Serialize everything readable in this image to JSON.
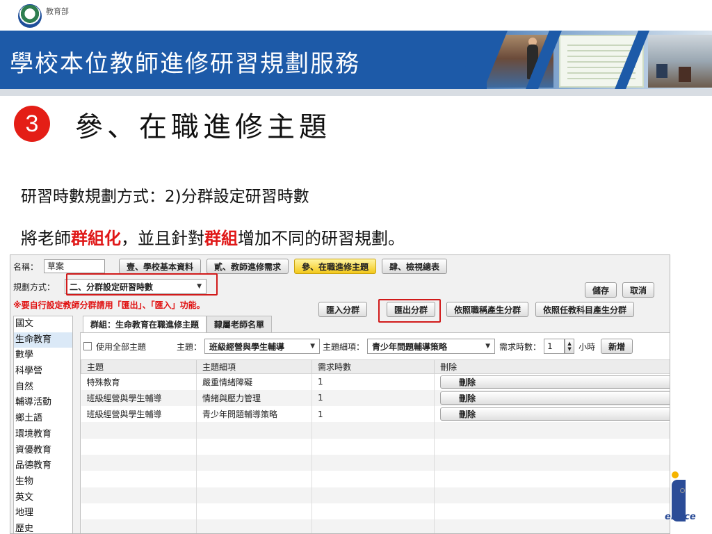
{
  "ministry": {
    "name": "教育部"
  },
  "banner": {
    "title": "學校本位教師進修研習規劃服務"
  },
  "step": {
    "number": "3",
    "title": "參、在職進修主題"
  },
  "description": {
    "line1": "研習時數規劃方式：2)分群設定研習時數",
    "line2_parts": [
      "將老師",
      "群組化",
      "，並且針對",
      "群組",
      "增加不同的研習規劃。"
    ]
  },
  "app": {
    "name_label": "名稱：",
    "name_value": "草案",
    "tabs": [
      "壹、學校基本資料",
      "貳、教師進修需求",
      "參、在職進修主題",
      "肆、檢視總表"
    ],
    "active_tab": 2,
    "plan_label": "規劃方式：",
    "plan_value": "二、分群設定研習時數",
    "save_label": "儲存",
    "cancel_label": "取消",
    "warning": "※要自行設定教師分群請用「匯出」、「匯入」功能。",
    "import_label": "匯入分群",
    "export_label": "匯出分群",
    "by_title_label": "依照職稱產生分群",
    "by_subject_label": "依照任教科目產生分群",
    "subjects": [
      "國文",
      "生命教育",
      "數學",
      "科學營",
      "自然",
      "輔導活動",
      "鄉土語",
      "環境教育",
      "資優教育",
      "品德教育",
      "生物",
      "英文",
      "地理",
      "歷史"
    ],
    "selected_subject": 1,
    "group_tab_label": "群組：生命教育在職進修主題",
    "member_tab_label": "隸屬老師名單",
    "use_all_label": "使用全部主題",
    "topic_label": "主題：",
    "topic_value": "班級經營與學生輔導",
    "subtopic_label": "主題細項：",
    "subtopic_value": "青少年問題輔導策略",
    "hours_label": "需求時數：",
    "hours_value": "1",
    "hours_unit": "小時",
    "add_label": "新增",
    "columns": [
      "主題",
      "主題細項",
      "需求時數",
      "刪除"
    ],
    "rows": [
      {
        "topic": "特殊教育",
        "subtopic": "嚴重情緒障礙",
        "hours": "1",
        "delete": "刪除"
      },
      {
        "topic": "班級經營與學生輔導",
        "subtopic": "情緒與壓力管理",
        "hours": "1",
        "delete": "刪除"
      },
      {
        "topic": "班級經營與學生輔導",
        "subtopic": "青少年問題輔導策略",
        "hours": "1",
        "delete": "刪除"
      }
    ]
  },
  "footer_logo": {
    "text": "ervice"
  }
}
